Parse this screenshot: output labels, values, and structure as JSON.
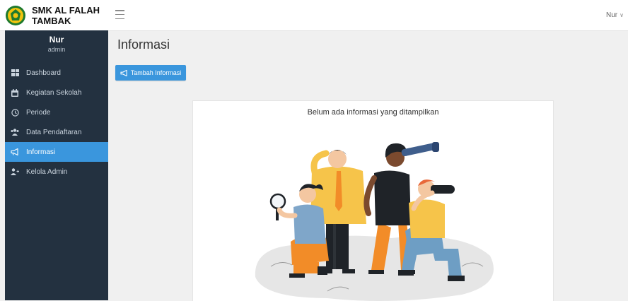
{
  "header": {
    "brand_name": "SMK AL FALAH\nTAMBAK",
    "user_label": "Nur",
    "user_chevron": "∨"
  },
  "sidebar": {
    "profile_name": "Nur",
    "profile_role": "admin",
    "items": [
      {
        "label": "Dashboard",
        "icon": "dashboard-icon"
      },
      {
        "label": "Kegiatan Sekolah",
        "icon": "calendar-icon"
      },
      {
        "label": "Periode",
        "icon": "clock-icon"
      },
      {
        "label": "Data Pendaftaran",
        "icon": "users-icon"
      },
      {
        "label": "Informasi",
        "icon": "megaphone-icon",
        "active": true
      },
      {
        "label": "Kelola Admin",
        "icon": "user-plus-icon"
      }
    ]
  },
  "main": {
    "title": "Informasi",
    "add_button_label": "Tambah Informasi",
    "empty_message": "Belum ada informasi yang ditampilkan"
  },
  "colors": {
    "sidebar_bg": "#233140",
    "accent": "#3a96dd",
    "page_bg": "#f0f0f0"
  }
}
